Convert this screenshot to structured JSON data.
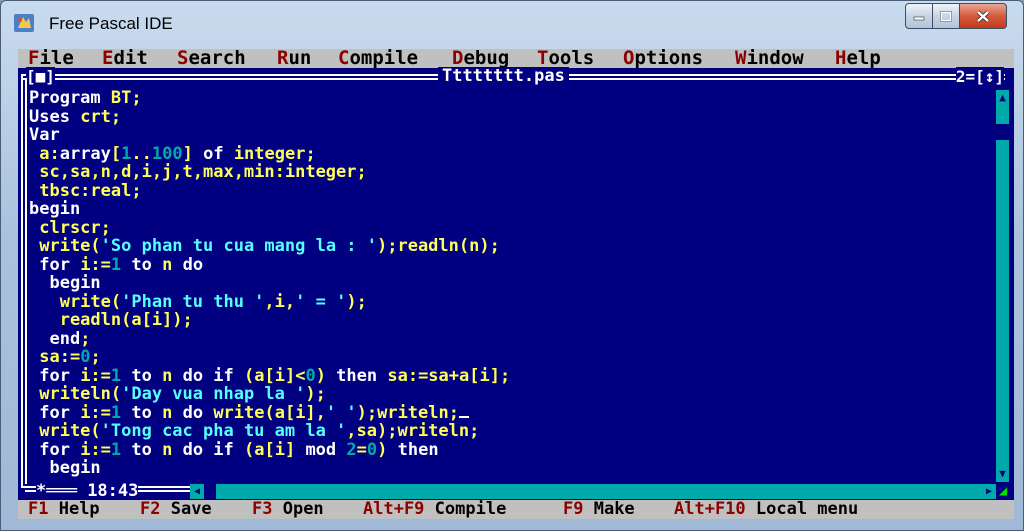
{
  "window": {
    "title": "Free Pascal IDE",
    "controls": {
      "minimize": "minimize",
      "maximize": "maximize",
      "close": "close"
    }
  },
  "menu": [
    {
      "hot": "F",
      "rest": "ile"
    },
    {
      "hot": "E",
      "rest": "dit"
    },
    {
      "hot": "S",
      "rest": "earch"
    },
    {
      "hot": "R",
      "rest": "un"
    },
    {
      "hot": "C",
      "rest": "ompile"
    },
    {
      "hot": "D",
      "rest": "ebug"
    },
    {
      "hot": "T",
      "rest": "ools"
    },
    {
      "hot": "O",
      "rest": "ptions"
    },
    {
      "hot": "W",
      "rest": "indow"
    },
    {
      "hot": "H",
      "rest": "elp"
    }
  ],
  "editor": {
    "filename": "Tttttttt.pas",
    "close_box": "[■]",
    "window_number": "2=[↕]",
    "cursor_position": "18:43",
    "code": [
      [
        [
          "w",
          "Program "
        ],
        [
          "y",
          "BT;"
        ]
      ],
      [
        [
          "w",
          "Uses "
        ],
        [
          "y",
          "crt;"
        ]
      ],
      [
        [
          "w",
          "Var"
        ]
      ],
      [
        [
          "y",
          " a:"
        ],
        [
          "w",
          "array"
        ],
        [
          "y",
          "["
        ],
        [
          "n",
          "1"
        ],
        [
          "y",
          ".."
        ],
        [
          "n",
          "100"
        ],
        [
          "y",
          "] "
        ],
        [
          "w",
          "of "
        ],
        [
          "y",
          "integer;"
        ]
      ],
      [
        [
          "y",
          " sc,sa,n,d,i,j,t,max,min:integer;"
        ]
      ],
      [
        [
          "y",
          " tbsc:real;"
        ]
      ],
      [
        [
          "w",
          "begin"
        ]
      ],
      [
        [
          "y",
          " clrscr;"
        ]
      ],
      [
        [
          "y",
          " write("
        ],
        [
          "c",
          "'So phan tu cua mang la : '"
        ],
        [
          "y",
          ");readln(n);"
        ]
      ],
      [
        [
          "w",
          " for "
        ],
        [
          "y",
          "i:="
        ],
        [
          "n",
          "1"
        ],
        [
          "w",
          " to "
        ],
        [
          "y",
          "n "
        ],
        [
          "w",
          "do"
        ]
      ],
      [
        [
          "w",
          "  begin"
        ]
      ],
      [
        [
          "y",
          "   write("
        ],
        [
          "c",
          "'Phan tu thu '"
        ],
        [
          "y",
          ",i,"
        ],
        [
          "c",
          "' = '"
        ],
        [
          "y",
          ");"
        ]
      ],
      [
        [
          "y",
          "   readln(a[i]);"
        ]
      ],
      [
        [
          "w",
          "  end"
        ],
        [
          "y",
          ";"
        ]
      ],
      [
        [
          "y",
          " sa:="
        ],
        [
          "n",
          "0"
        ],
        [
          "y",
          ";"
        ]
      ],
      [
        [
          "w",
          " for "
        ],
        [
          "y",
          "i:="
        ],
        [
          "n",
          "1"
        ],
        [
          "w",
          " to "
        ],
        [
          "y",
          "n "
        ],
        [
          "w",
          "do if "
        ],
        [
          "y",
          "(a[i]<"
        ],
        [
          "n",
          "0"
        ],
        [
          "y",
          ") "
        ],
        [
          "w",
          "then "
        ],
        [
          "y",
          "sa:=sa+a[i];"
        ]
      ],
      [
        [
          "y",
          " writeln("
        ],
        [
          "c",
          "'Day vua nhap la '"
        ],
        [
          "y",
          ");"
        ]
      ],
      [
        [
          "w",
          " for "
        ],
        [
          "y",
          "i:="
        ],
        [
          "n",
          "1"
        ],
        [
          "w",
          " to "
        ],
        [
          "y",
          "n "
        ],
        [
          "w",
          "do "
        ],
        [
          "y",
          "write(a[i],"
        ],
        [
          "c",
          "' '"
        ],
        [
          "y",
          ");writeln;"
        ],
        [
          "cursor",
          ""
        ]
      ],
      [
        [
          "y",
          " write("
        ],
        [
          "c",
          "'Tong cac pha tu am la '"
        ],
        [
          "y",
          ",sa);writeln;"
        ]
      ],
      [
        [
          "w",
          " for "
        ],
        [
          "y",
          "i:="
        ],
        [
          "n",
          "1"
        ],
        [
          "w",
          " to "
        ],
        [
          "y",
          "n "
        ],
        [
          "w",
          "do if "
        ],
        [
          "y",
          "(a[i] "
        ],
        [
          "w",
          "mod "
        ],
        [
          "n",
          "2"
        ],
        [
          "y",
          "="
        ],
        [
          "n",
          "0"
        ],
        [
          "y",
          ") "
        ],
        [
          "w",
          "then"
        ]
      ],
      [
        [
          "w",
          "  begin"
        ]
      ]
    ]
  },
  "statusbar": [
    {
      "key": "F1",
      "label": " Help"
    },
    {
      "key": "F2",
      "label": " Save"
    },
    {
      "key": "F3",
      "label": " Open"
    },
    {
      "key": "Alt+F9",
      "label": " Compile"
    },
    {
      "key": "F9",
      "label": " Make"
    },
    {
      "key": "Alt+F10",
      "label": " Local menu"
    }
  ]
}
